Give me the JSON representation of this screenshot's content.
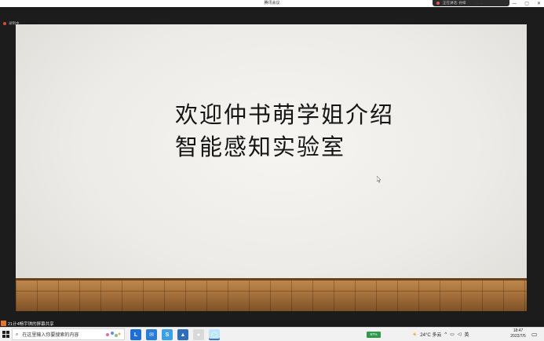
{
  "window": {
    "title": "腾讯会议",
    "min": "—",
    "max": "▢",
    "close": "✕"
  },
  "speaking": {
    "text": "正在讲话: 孙梓",
    "dots": "····"
  },
  "recording": {
    "label": "录制中"
  },
  "slide": {
    "line1": "欢迎仲书萌学姐介绍",
    "line2": "智能感知实验室"
  },
  "share": {
    "status": "21计4畅宇琪的屏幕共享"
  },
  "taskbar": {
    "search_placeholder": "在这里输入你要搜索的内容",
    "apps": [
      {
        "name": "task-view",
        "glyph": "L",
        "color": "#1d6fd6"
      },
      {
        "name": "mail",
        "glyph": "✉",
        "color": "#2a7ad8"
      },
      {
        "name": "browser",
        "glyph": "S",
        "color": "#3aa0e8"
      },
      {
        "name": "photos",
        "glyph": "▲",
        "color": "#2f6fb8"
      },
      {
        "name": "chrome",
        "glyph": "●",
        "color": "#d9d9d9"
      },
      {
        "name": "meeting",
        "glyph": "◯",
        "color": "#bfe6f5"
      }
    ],
    "battery": "97%",
    "weather": "24°C 多云",
    "ime": "英",
    "time": "18:47",
    "date": "2022/7/5"
  }
}
